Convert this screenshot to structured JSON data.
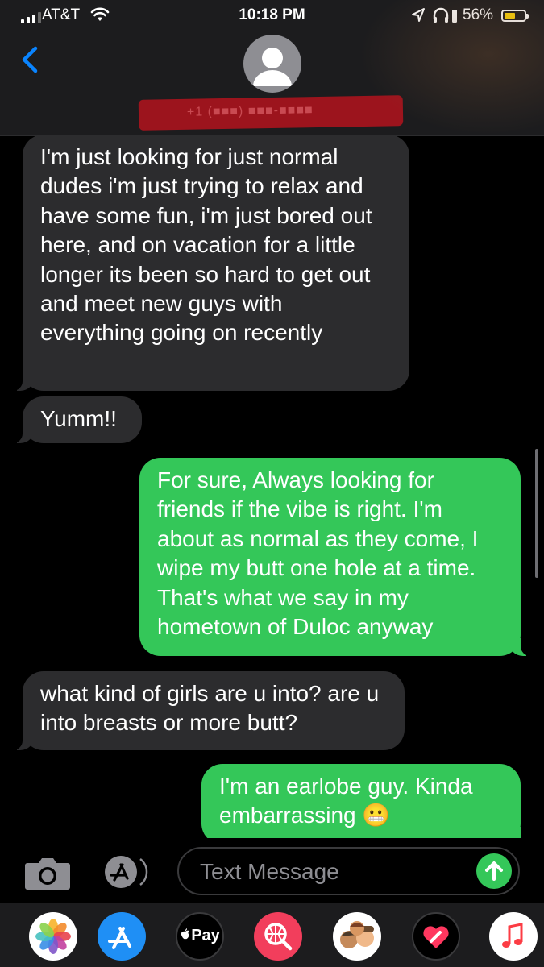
{
  "status_bar": {
    "carrier": "AT&T",
    "time": "10:18 PM",
    "battery": "56%",
    "battery_level": 0.56
  },
  "contact": {
    "redacted_number": "+1 (■■■) ■■■-■■■■"
  },
  "messages": [
    {
      "direction": "incoming",
      "text": "I'm just looking for just normal dudes i'm just trying to relax and have some fun, i'm just bored out here, and on vacation for a little longer its been so hard to get out and meet new guys with everything going on recently"
    },
    {
      "direction": "incoming",
      "text": "Yumm!!"
    },
    {
      "direction": "outgoing",
      "text": "For sure, Always looking for friends if the vibe is right. I'm about as normal as they come, I wipe my butt one hole at a time. That's what we say in my hometown of Duloc anyway"
    },
    {
      "direction": "incoming",
      "text": "what kind of girls are u into? are u into breasts or more butt?"
    },
    {
      "direction": "outgoing",
      "text": "I'm an earlobe guy. Kinda embarrassing 😬"
    }
  ],
  "input": {
    "placeholder": "Text Message"
  },
  "app_drawer": {
    "apple_pay_label": "Pay",
    "icons": [
      "photos-icon",
      "app-store-icon",
      "apple-pay-icon",
      "web-search-icon",
      "memoji-icon",
      "digital-touch-icon",
      "music-icon"
    ]
  },
  "colors": {
    "incoming_bubble": "#2c2c2e",
    "outgoing_bubble": "#34c759",
    "back_chevron": "#0a84ff",
    "header_bg": "#1c1c1e"
  }
}
